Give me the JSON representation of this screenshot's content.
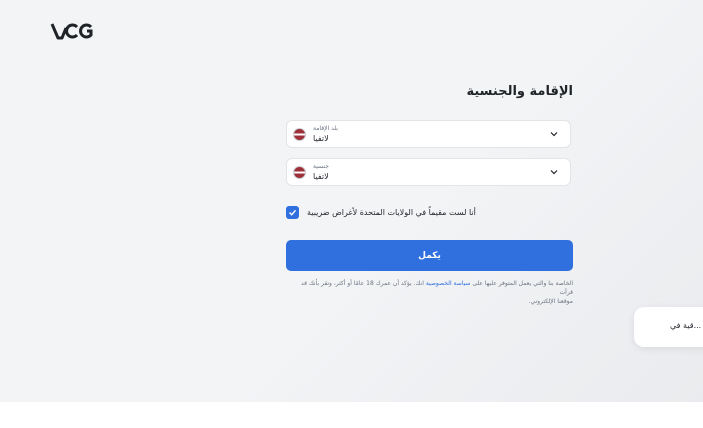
{
  "brand": {
    "logo_text": "VCG"
  },
  "page": {
    "title": "الإقامة والجنسية"
  },
  "residence": {
    "label": "بلد الإقامة",
    "value": "لاتفيا",
    "flag": "latvia-flag"
  },
  "citizenship": {
    "label": "جنسية",
    "value": "لاتفيا",
    "flag": "latvia-flag"
  },
  "us_checkbox": {
    "label": "أنا لست مقيماً في الولايات المتحدة لأغراض ضريبية",
    "checked": true
  },
  "continue_button": {
    "label": "يكمل"
  },
  "legal": {
    "line1_before": "الخاصة بنا والتي يعمل المتوفر عليها على",
    "link": "سياسة الخصوصية",
    "line1_after": "انك. يؤكد أن عمرك 18 عامًا أو أكثر، وتقر بأنك قد قرأت",
    "line2": "موقعنا الإلكتروني."
  },
  "toast": {
    "text": "قية في..."
  },
  "colors": {
    "accent": "#2f6fde",
    "background": "#f3f4f6"
  }
}
